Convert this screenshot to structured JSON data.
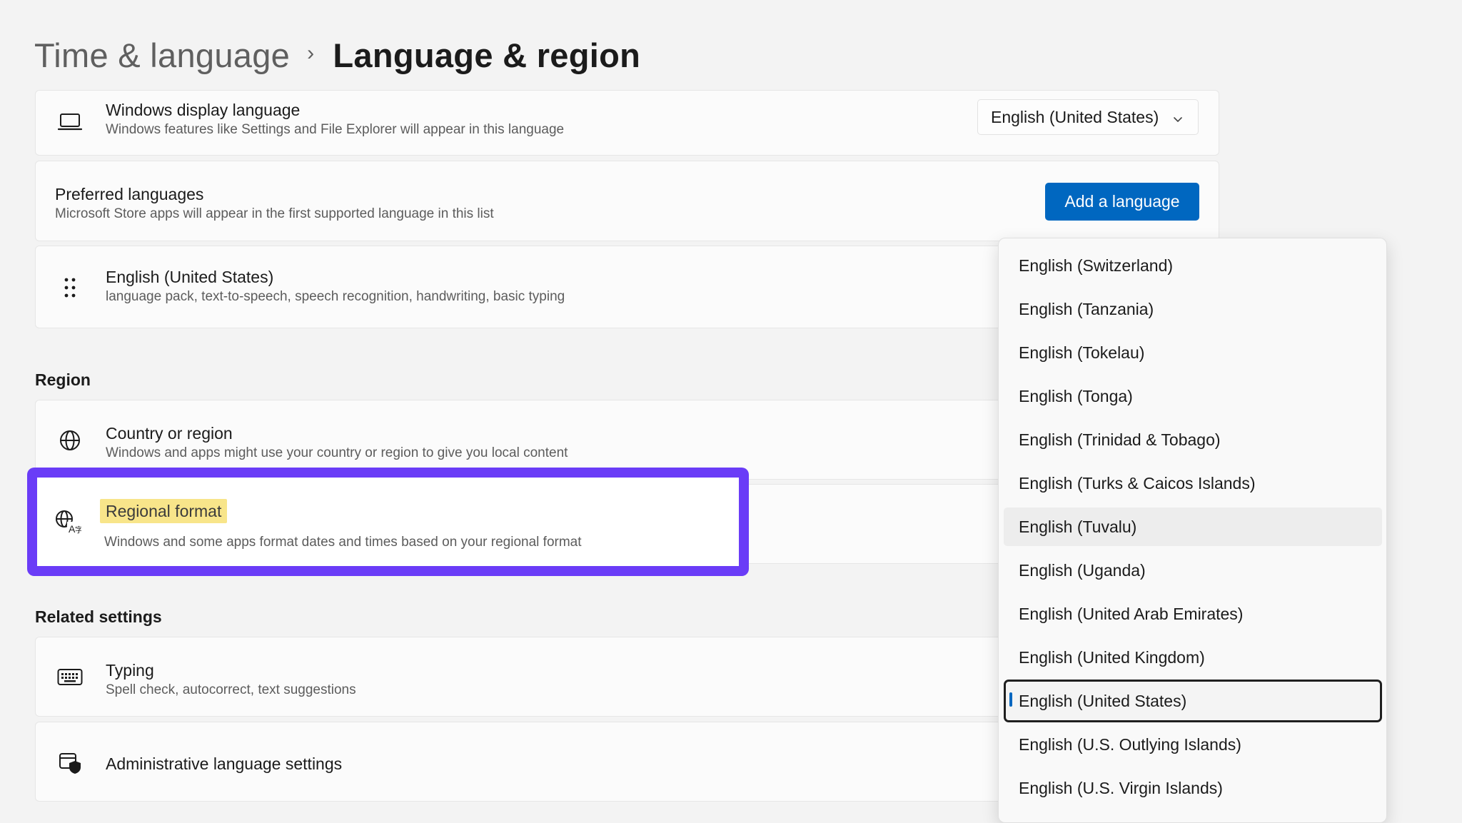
{
  "breadcrumb": {
    "parent": "Time & language",
    "separator": "›",
    "current": "Language & region"
  },
  "display_language": {
    "icon": "laptop-icon",
    "title": "Windows display language",
    "subtitle": "Windows features like Settings and File Explorer will appear in this language",
    "selected_value": "English (United States)"
  },
  "preferred_languages": {
    "title": "Preferred languages",
    "subtitle": "Microsoft Store apps will appear in the first supported language in this list",
    "add_button_label": "Add a language"
  },
  "installed_language": {
    "icon": "drag-handle-icon",
    "title": "English (United States)",
    "subtitle": "language pack, text-to-speech, speech recognition, handwriting, basic typing"
  },
  "region_section": {
    "heading": "Region",
    "country": {
      "icon": "globe-icon",
      "title": "Country or region",
      "subtitle": "Windows and apps might use your country or region to give you local content"
    },
    "regional_format": {
      "icon": "regional-format-icon",
      "title": "Regional format",
      "subtitle": "Windows and some apps format dates and times based on your regional format"
    }
  },
  "related_section": {
    "heading": "Related settings",
    "typing": {
      "icon": "keyboard-icon",
      "title": "Typing",
      "subtitle": "Spell check, autocorrect, text suggestions"
    },
    "admin": {
      "icon": "admin-shield-icon",
      "title": "Administrative language settings"
    }
  },
  "dropdown": {
    "items": [
      "English (Switzerland)",
      "English (Tanzania)",
      "English (Tokelau)",
      "English (Tonga)",
      "English (Trinidad & Tobago)",
      "English (Turks & Caicos Islands)",
      "English (Tuvalu)",
      "English (Uganda)",
      "English (United Arab Emirates)",
      "English (United Kingdom)",
      "English (United States)",
      "English (U.S. Outlying Islands)",
      "English (U.S. Virgin Islands)"
    ],
    "hovered_item": "English (Tuvalu)",
    "selected_item": "English (United States)"
  },
  "colors": {
    "accent": "#0067c0",
    "highlight_border": "#6a3cf7",
    "text_highlight": "#f8e58a"
  }
}
